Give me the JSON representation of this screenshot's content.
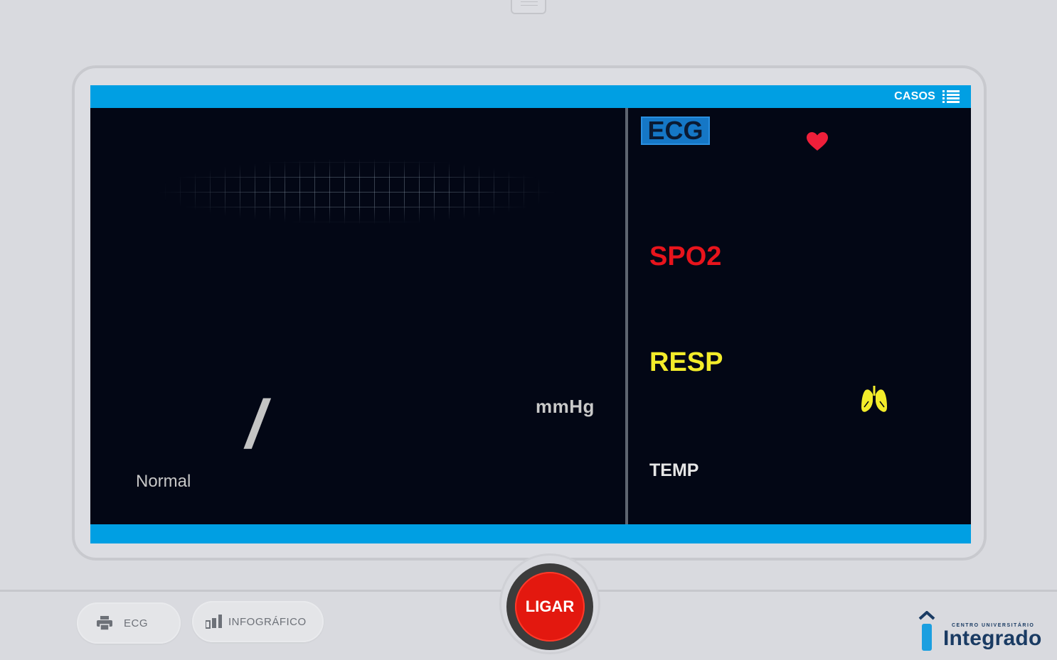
{
  "header": {
    "casos_label": "CASOS",
    "casos_icon": "list-icon"
  },
  "monitor": {
    "blood_pressure": {
      "separator": "/",
      "unit": "mmHg",
      "status": "Normal"
    },
    "ecg": {
      "label": "ECG",
      "icon": "heart-icon",
      "icon_color": "#ef1f3a"
    },
    "spo2": {
      "label": "SPO2",
      "color": "#e8141c"
    },
    "resp": {
      "label": "RESP",
      "icon": "lungs-icon",
      "color": "#f3ec2a"
    },
    "temp": {
      "label": "TEMP",
      "color": "#e6e6e6"
    }
  },
  "footer": {
    "ecg_button": {
      "label": "ECG",
      "icon": "printer-icon"
    },
    "info_button": {
      "label": "INFOGRÁFICO",
      "icon": "bar-chart-icon"
    },
    "power_button": {
      "label": "LIGAR",
      "color": "#e3180f"
    },
    "logo": {
      "small": "CENTRO UNIVERSITÁRIO",
      "big": "Integrado"
    }
  },
  "colors": {
    "accent": "#009fe3",
    "screen_bg": "#030715",
    "page_bg": "#d9dadf"
  }
}
